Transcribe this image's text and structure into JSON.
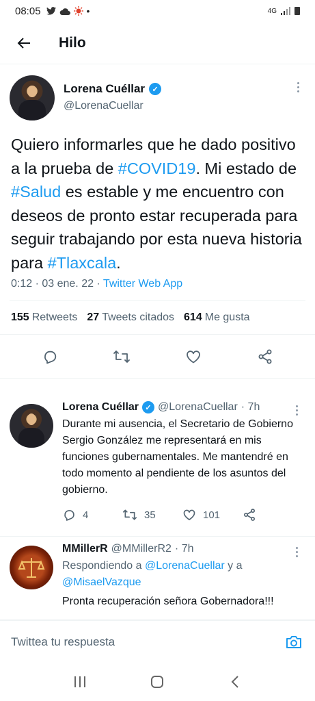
{
  "status_bar": {
    "time": "08:05",
    "network": "4G"
  },
  "app_bar": {
    "title": "Hilo"
  },
  "main_tweet": {
    "author_name": "Lorena Cuéllar",
    "author_handle": "@LorenaCuellar",
    "text_parts": [
      "Quiero informarles que he dado positivo a la prueba de ",
      "#COVID19",
      ". Mi estado de ",
      "#Salud",
      " es estable y me encuentro con deseos de pronto estar recuperada para seguir trabajando por esta nueva historia para ",
      "#Tlaxcala",
      "."
    ],
    "timestamp": "0:12 · 03 ene. 22 · ",
    "source": "Twitter Web App",
    "stats": {
      "retweets_count": "155",
      "retweets_label": "Retweets",
      "quotes_count": "27",
      "quotes_label": "Tweets citados",
      "likes_count": "614",
      "likes_label": "Me gusta"
    }
  },
  "replies": [
    {
      "author_name": "Lorena Cuéllar",
      "author_handle": "@LorenaCuellar",
      "time": "· 7h",
      "text": "Durante mi ausencia, el Secretario de Gobierno Sergio González me representará en mis funciones gubernamentales. Me mantendré en todo momento al pendiente de los asuntos del gobierno.",
      "reply_count": "4",
      "retweet_count": "35",
      "like_count": "101"
    },
    {
      "author_name": "MMillerR",
      "author_handle": "@MMillerR2",
      "time": "· 7h",
      "replying_prefix": "Respondiendo a ",
      "replying_user1": "@LorenaCuellar",
      "replying_joiner": " y a",
      "replying_user2": "@MisaelVazque",
      "text": "Pronta recuperación señora Gobernadora!!!"
    }
  ],
  "composer": {
    "placeholder": "Twittea tu respuesta"
  },
  "colors": {
    "accent": "#1d9bf0",
    "secondary_text": "#536471"
  }
}
